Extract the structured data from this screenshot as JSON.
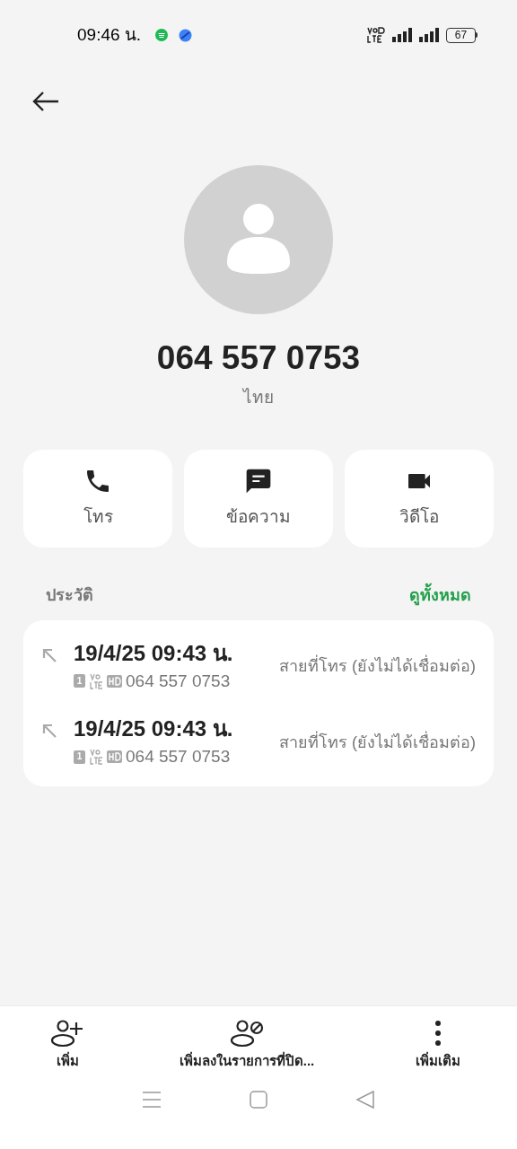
{
  "status_bar": {
    "time": "09:46 น.",
    "battery": "67"
  },
  "contact": {
    "number": "064 557 0753",
    "country": "ไทย"
  },
  "actions": [
    {
      "kind": "call",
      "label": "โทร"
    },
    {
      "kind": "message",
      "label": "ข้อความ"
    },
    {
      "kind": "video",
      "label": "วิดีโอ"
    }
  ],
  "history": {
    "title": "ประวัติ",
    "view_all": "ดูทั้งหมด",
    "entries": [
      {
        "datetime": "19/4/25 09:43 น.",
        "sim": "1",
        "number": "064 557 0753",
        "status": "สายที่โทร (ยังไม่ได้เชื่อมต่อ)"
      },
      {
        "datetime": "19/4/25 09:43 น.",
        "sim": "1",
        "number": "064 557 0753",
        "status": "สายที่โทร (ยังไม่ได้เชื่อมต่อ)"
      }
    ]
  },
  "bottom_bar": [
    {
      "kind": "add",
      "label": "เพิ่ม"
    },
    {
      "kind": "block",
      "label": "เพิ่มลงในรายการที่ปิด..."
    },
    {
      "kind": "more",
      "label": "เพิ่มเติม"
    }
  ]
}
